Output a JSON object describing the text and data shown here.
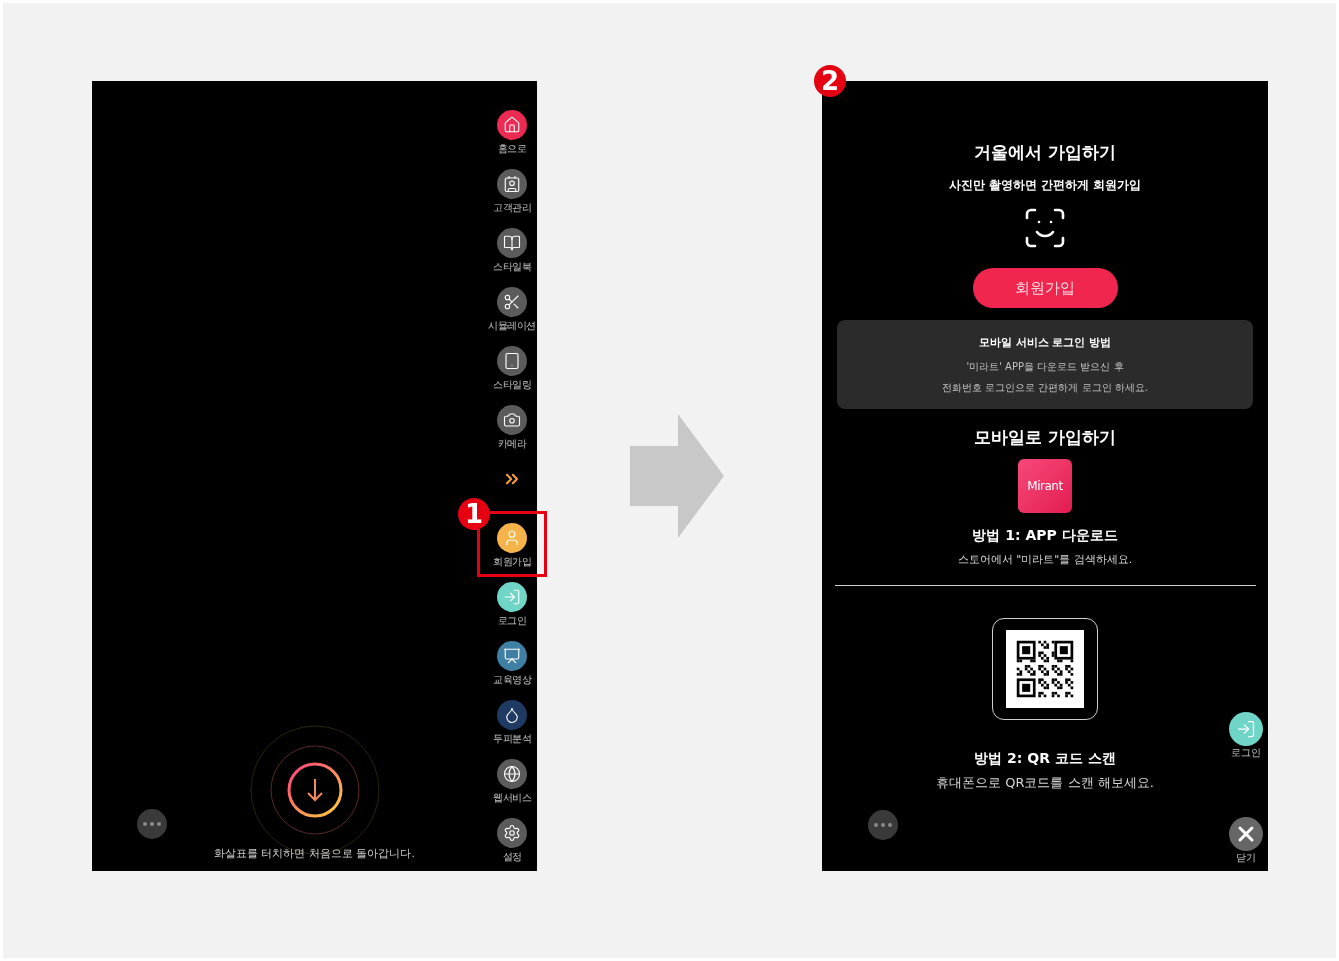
{
  "left_screen": {
    "badge": "1",
    "sidebar": [
      {
        "kind": "button",
        "label": "홈으로",
        "color": "#ec2a52",
        "highlighted": false
      },
      {
        "kind": "button",
        "label": "고객관리",
        "color": "#5b5b5b",
        "highlighted": false
      },
      {
        "kind": "button",
        "label": "스타일북",
        "color": "#5b5b5b",
        "highlighted": false
      },
      {
        "kind": "button",
        "label": "시뮬레이션",
        "color": "#5b5b5b",
        "highlighted": false
      },
      {
        "kind": "button",
        "label": "스타일링",
        "color": "#5b5b5b",
        "highlighted": false
      },
      {
        "kind": "button",
        "label": "카메라",
        "color": "#5b5b5b",
        "highlighted": false
      },
      {
        "kind": "expand"
      },
      {
        "kind": "button",
        "label": "회원가입",
        "color": "#f6b34a",
        "highlighted": true
      },
      {
        "kind": "button",
        "label": "로그인",
        "color": "#6fd6c7",
        "highlighted": false
      },
      {
        "kind": "button",
        "label": "교육영상",
        "color": "#3f7fa3",
        "highlighted": false
      },
      {
        "kind": "button",
        "label": "두피분석",
        "color": "#1f3b63",
        "highlighted": false
      },
      {
        "kind": "button",
        "label": "웹서비스",
        "color": "#5b5b5b",
        "highlighted": false
      },
      {
        "kind": "button",
        "label": "설정",
        "color": "#5b5b5b",
        "highlighted": false
      }
    ],
    "hint": "화살표를 터치하면 처음으로 돌아갑니다."
  },
  "right_screen": {
    "badge": "2",
    "mirror_signup": {
      "title": "거울에서 가입하기",
      "subtitle": "사진만 촬영하면 간편하게 회원가입",
      "button": "회원가입"
    },
    "info_box": {
      "title": "모바일 서비스 로그인 방법",
      "lines": [
        "'미라트' APP을 다운로드 받으신 후",
        "전화번호 로그인으로 간편하게 로그인 하세요."
      ]
    },
    "mobile_signup": {
      "title": "모바일로 가입하기",
      "app_logo": "Mirant",
      "method_1_title": "방법 1: APP 다운로드",
      "method_1_text": "스토어에서 \"미라트\"를 검색하세요.",
      "method_2_title": "방법 2: QR 코드 스캔",
      "method_2_text": "휴대폰으로 QR코드를 스캔 해보세요."
    },
    "login_button": "로그인",
    "close_button": "닫기"
  }
}
